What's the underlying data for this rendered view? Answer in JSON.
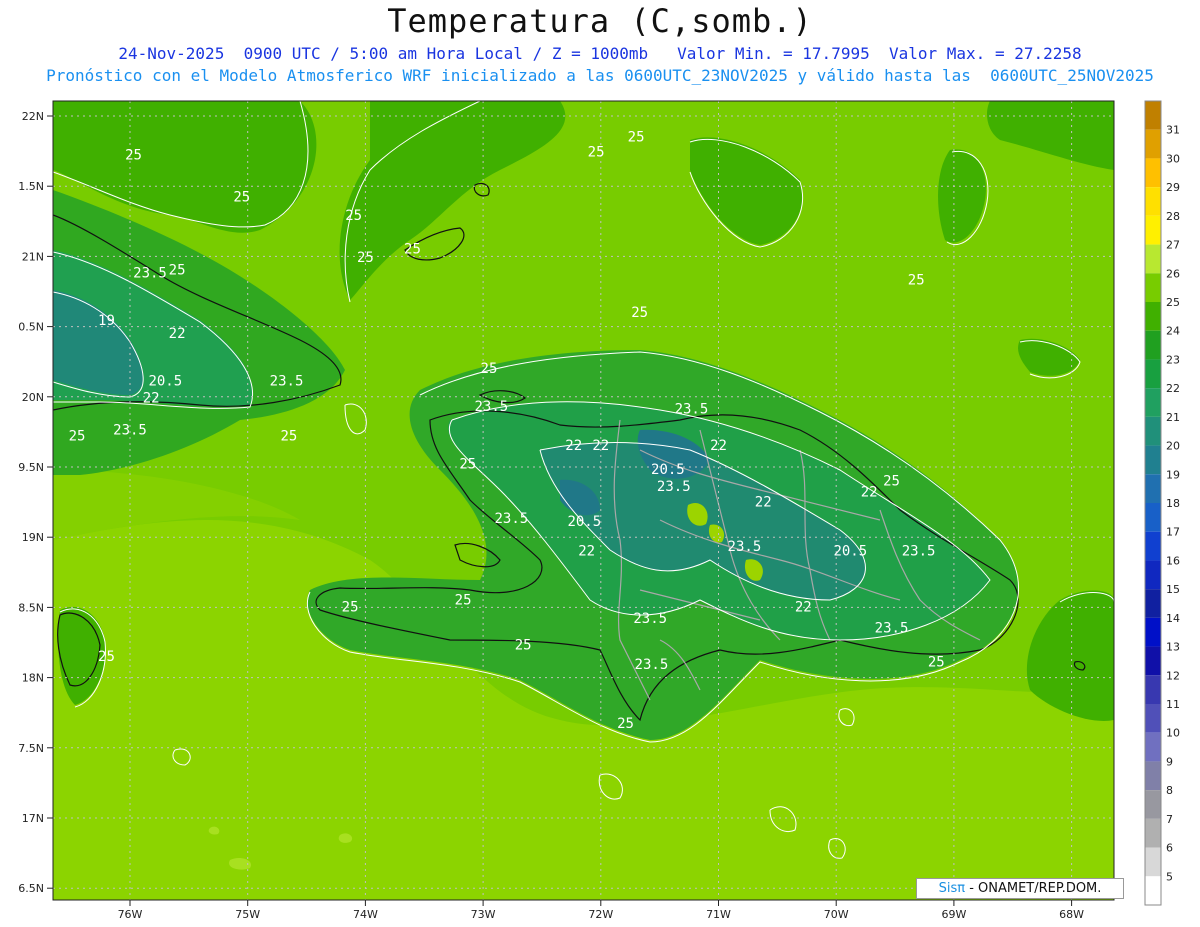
{
  "title": "Temperatura (C,somb.)",
  "subtitle_line1": "24-Nov-2025  0900 UTC / 5:00 am Hora Local / Z = 1000mb   Valor Min. = 17.7995  Valor Max. = 27.2258",
  "subtitle_line2": "Pronóstico con el Modelo Atmosferico WRF inicializado a las 0600UTC_23NOV2025 y válido hasta las  0600UTC_25NOV2025",
  "credit": {
    "brand": "Sisπ",
    "text": " - ONAMET/REP.DOM."
  },
  "lat_labels": [
    "22N",
    "1.5N",
    "21N",
    "0.5N",
    "20N",
    "9.5N",
    "19N",
    "8.5N",
    "18N",
    "7.5N",
    "17N",
    "6.5N"
  ],
  "lon_labels": [
    "76W",
    "75W",
    "74W",
    "73W",
    "72W",
    "71W",
    "70W",
    "69W",
    "68W"
  ],
  "colorbar": {
    "labels": [
      "31",
      "30",
      "29",
      "28",
      "27",
      "26",
      "25",
      "24",
      "23",
      "22",
      "21",
      "20",
      "19",
      "18",
      "17",
      "16",
      "15",
      "14",
      "13",
      "12",
      "11",
      "10",
      "9",
      "8",
      "7",
      "6",
      "5"
    ],
    "colors": [
      "#c08000",
      "#e0a000",
      "#ffc000",
      "#ffe000",
      "#fff000",
      "#b8e830",
      "#78cc00",
      "#40b000",
      "#20a020",
      "#18a040",
      "#20a060",
      "#20907a",
      "#208090",
      "#2070b0",
      "#1860c8",
      "#1040d0",
      "#1028c0",
      "#1020a0",
      "#0010c8",
      "#1010a8",
      "#3838b0",
      "#5050b8",
      "#7070c0",
      "#8080a8",
      "#9898a0",
      "#b0b0b0",
      "#d8d8d8",
      "#ffffff"
    ]
  },
  "contour_labels": [
    {
      "text": "25",
      "lon": -75.97,
      "lat": 21.69
    },
    {
      "text": "25",
      "lon": -75.05,
      "lat": 21.39
    },
    {
      "text": "25",
      "lon": -74.1,
      "lat": 21.26
    },
    {
      "text": "25",
      "lon": -73.6,
      "lat": 21.02
    },
    {
      "text": "25",
      "lon": -74.0,
      "lat": 20.96
    },
    {
      "text": "23.5",
      "lon": -75.83,
      "lat": 20.85
    },
    {
      "text": "25",
      "lon": -75.6,
      "lat": 20.87
    },
    {
      "text": "19",
      "lon": -76.2,
      "lat": 20.51
    },
    {
      "text": "22",
      "lon": -75.6,
      "lat": 20.42
    },
    {
      "text": "20.5",
      "lon": -75.7,
      "lat": 20.08
    },
    {
      "text": "22",
      "lon": -75.82,
      "lat": 19.96
    },
    {
      "text": "23.5",
      "lon": -74.67,
      "lat": 20.08
    },
    {
      "text": "23.5",
      "lon": -76.0,
      "lat": 19.73
    },
    {
      "text": "25",
      "lon": -76.45,
      "lat": 19.69
    },
    {
      "text": "25",
      "lon": -74.65,
      "lat": 19.69
    },
    {
      "text": "25",
      "lon": -72.04,
      "lat": 21.71
    },
    {
      "text": "25",
      "lon": -71.7,
      "lat": 21.82
    },
    {
      "text": "25",
      "lon": -69.32,
      "lat": 20.8
    },
    {
      "text": "25",
      "lon": -71.67,
      "lat": 20.57
    },
    {
      "text": "25",
      "lon": -72.95,
      "lat": 20.17
    },
    {
      "text": "23.5",
      "lon": -72.93,
      "lat": 19.9
    },
    {
      "text": "23.5",
      "lon": -71.23,
      "lat": 19.88
    },
    {
      "text": "22",
      "lon": -72.23,
      "lat": 19.62
    },
    {
      "text": "22",
      "lon": -72.0,
      "lat": 19.62
    },
    {
      "text": "22",
      "lon": -71.0,
      "lat": 19.62
    },
    {
      "text": "25",
      "lon": -73.13,
      "lat": 19.49
    },
    {
      "text": "20.5",
      "lon": -71.43,
      "lat": 19.45
    },
    {
      "text": "23.5",
      "lon": -71.38,
      "lat": 19.33
    },
    {
      "text": "22",
      "lon": -70.62,
      "lat": 19.22
    },
    {
      "text": "25",
      "lon": -69.53,
      "lat": 19.37
    },
    {
      "text": "22",
      "lon": -69.72,
      "lat": 19.29
    },
    {
      "text": "23.5",
      "lon": -72.76,
      "lat": 19.1
    },
    {
      "text": "20.5",
      "lon": -72.14,
      "lat": 19.08
    },
    {
      "text": "22",
      "lon": -72.12,
      "lat": 18.87
    },
    {
      "text": "23.5",
      "lon": -70.78,
      "lat": 18.9
    },
    {
      "text": "20.5",
      "lon": -69.88,
      "lat": 18.87
    },
    {
      "text": "23.5",
      "lon": -69.3,
      "lat": 18.87
    },
    {
      "text": "25",
      "lon": -73.17,
      "lat": 18.52
    },
    {
      "text": "25",
      "lon": -74.13,
      "lat": 18.47
    },
    {
      "text": "22",
      "lon": -70.28,
      "lat": 18.47
    },
    {
      "text": "23.5",
      "lon": -71.58,
      "lat": 18.39
    },
    {
      "text": "23.5",
      "lon": -69.53,
      "lat": 18.32
    },
    {
      "text": "25",
      "lon": -72.66,
      "lat": 18.2
    },
    {
      "text": "23.5",
      "lon": -71.57,
      "lat": 18.06
    },
    {
      "text": "25",
      "lon": -76.2,
      "lat": 18.12
    },
    {
      "text": "25",
      "lon": -69.15,
      "lat": 18.08
    },
    {
      "text": "25",
      "lon": -71.79,
      "lat": 17.64
    }
  ]
}
